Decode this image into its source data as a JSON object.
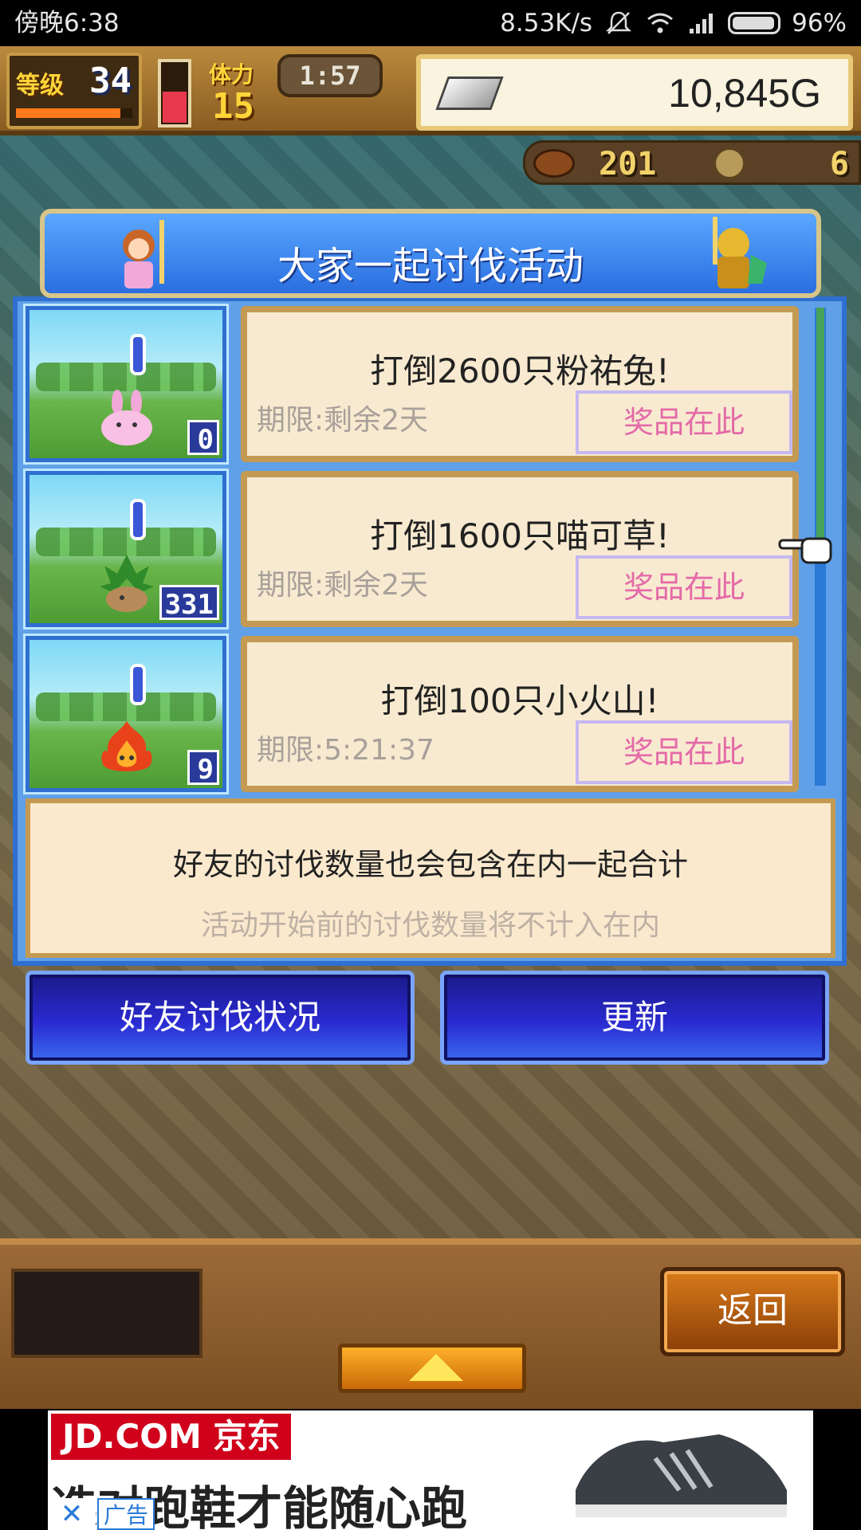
{
  "status_bar": {
    "time": "傍晚6:38",
    "net_speed": "8.53K/s",
    "battery": "96%"
  },
  "hud": {
    "level_label": "等级",
    "level": "34",
    "level_progress": 0.9,
    "stamina_label": "体力",
    "stamina": "15",
    "stamina_level": 0.5,
    "timer": "1:57",
    "gold": "10,845G",
    "food": "201",
    "coins": "6"
  },
  "event": {
    "title": "大家一起讨伐活动",
    "tasks": [
      {
        "title": "打倒2600只粉祐兔!",
        "deadline": "期限:剩余2天",
        "prize": "奖品在此",
        "count": "0",
        "monster": "pink-rabbit"
      },
      {
        "title": "打倒1600只喵可草!",
        "deadline": "期限:剩余2天",
        "prize": "奖品在此",
        "count": "331",
        "monster": "grass-creature"
      },
      {
        "title": "打倒100只小火山!",
        "deadline": "期限:5:21:37",
        "prize": "奖品在此",
        "count": "9",
        "monster": "fire-creature"
      }
    ],
    "note_main": "好友的讨伐数量也会包含在内一起合计",
    "note_sub": "活动开始前的讨伐数量将不计入在内",
    "friend_button": "好友讨伐状况",
    "refresh_button": "更新"
  },
  "bottom": {
    "back_button": "返回"
  },
  "ad": {
    "brand": "JD.COM 京东",
    "slogan": "选对跑鞋才能随心跑",
    "close": "✕",
    "tag": "广告"
  },
  "colors": {
    "panel_blue": "#2f6fd0",
    "prize_pink": "#e46aa8",
    "gold_text": "#ffd53a"
  }
}
